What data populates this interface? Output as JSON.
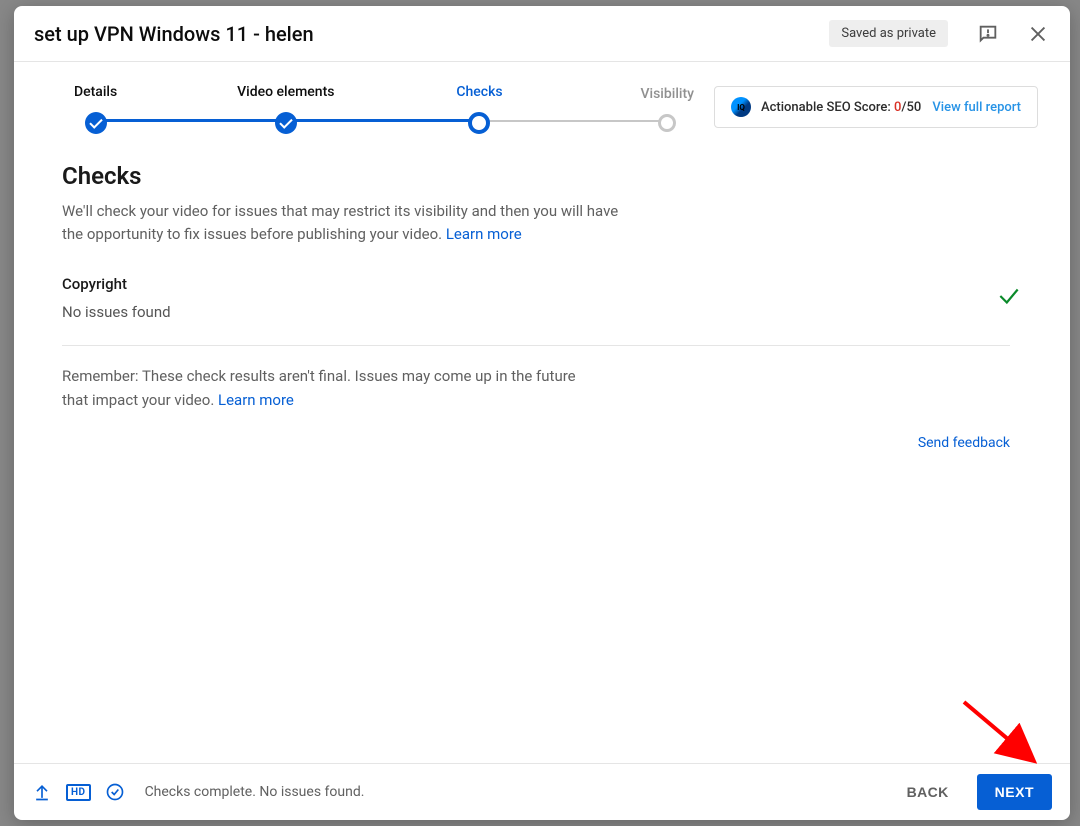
{
  "header": {
    "title": "set up VPN Windows 11 - helen",
    "saved_label": "Saved as private"
  },
  "stepper": {
    "steps": [
      {
        "label": "Details"
      },
      {
        "label": "Video elements"
      },
      {
        "label": "Checks"
      },
      {
        "label": "Visibility"
      }
    ]
  },
  "seo": {
    "label_prefix": "Actionable SEO Score: ",
    "score": "0",
    "score_suffix": "/50",
    "link": "View full report"
  },
  "checks": {
    "heading": "Checks",
    "intro": "We'll check your video for issues that may restrict its visibility and then you will have the opportunity to fix issues before publishing your video. ",
    "learn_more": "Learn more",
    "copyright_title": "Copyright",
    "copyright_status": "No issues found",
    "remember": "Remember: These check results aren't final. Issues may come up in the future that impact your video. ",
    "send_feedback": "Send feedback"
  },
  "footer": {
    "status": "Checks complete. No issues found.",
    "back": "BACK",
    "next": "NEXT",
    "hd": "HD"
  }
}
